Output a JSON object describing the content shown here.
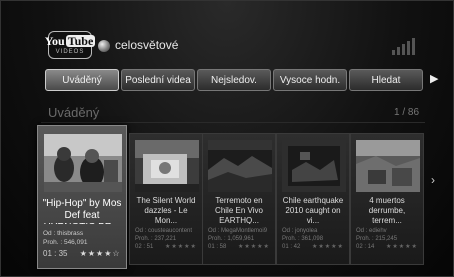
{
  "header": {
    "logo_you": "You",
    "logo_tube": "Tube",
    "logo_sub": "VIDEOS",
    "region_label": "celosvětové"
  },
  "nav": {
    "tabs": [
      {
        "label": "Uváděný",
        "active": true
      },
      {
        "label": "Poslední videa",
        "active": false
      },
      {
        "label": "Nejsledov.",
        "active": false
      },
      {
        "label": "Vysoce hodn.",
        "active": false
      },
      {
        "label": "Hledat",
        "active": false
      }
    ],
    "next_icon": "▶"
  },
  "section": {
    "title": "Uváděný",
    "page_count": "1 / 86"
  },
  "videos": [
    {
      "title": "\"Hip-Hop\" by Mos Def feat HYPNOTIC BR...",
      "author": "Od : thisbrass",
      "views": "Proh. : 546,091",
      "duration": "01 : 35",
      "stars": "★★★★☆"
    },
    {
      "title": "The Silent World dazzles - Le Mon...",
      "author": "Od : cousteaucontent",
      "views": "Proh. : 237,221",
      "duration": "02 : 51",
      "stars": "★★★★★"
    },
    {
      "title": "Terremoto en Chile En Vivo EARTHQ...",
      "author": "Od : MegaMontlemoi9",
      "views": "Proh. : 1,059,961",
      "duration": "01 : 58",
      "stars": "★★★★★"
    },
    {
      "title": "Chile earthquake 2010 caught on vi...",
      "author": "Od : jonyolea",
      "views": "Proh. : 361,098",
      "duration": "01 : 42",
      "stars": "★★★★★"
    },
    {
      "title": "4 muertos derrumbe, terrem...",
      "author": "Od : ediehv",
      "views": "Proh. : 215,245",
      "duration": "02 : 14",
      "stars": "★★★★★"
    }
  ],
  "cards_next_icon": "›"
}
